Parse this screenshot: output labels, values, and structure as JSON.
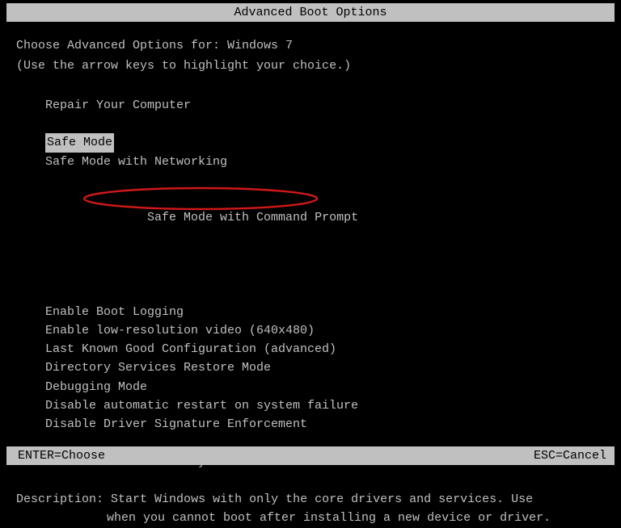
{
  "title": "Advanced Boot Options",
  "instruction1": "Choose Advanced Options for: Windows 7",
  "instruction2": "(Use the arrow keys to highlight your choice.)",
  "menu": {
    "repair": "Repair Your Computer",
    "safe_mode": "Safe Mode",
    "safe_mode_net": "Safe Mode with Networking",
    "safe_mode_cmd": "Safe Mode with Command Prompt",
    "boot_logging": "Enable Boot Logging",
    "low_res": "Enable low-resolution video (640x480)",
    "last_known": "Last Known Good Configuration (advanced)",
    "ds_restore": "Directory Services Restore Mode",
    "debugging": "Debugging Mode",
    "disable_restart": "Disable automatic restart on system failure",
    "disable_driver_sig": "Disable Driver Signature Enforcement",
    "start_normal": "Start Windows Normally"
  },
  "description": {
    "label": "Description:",
    "line1": "Start Windows with only the core drivers and services. Use",
    "line2": "when you cannot boot after installing a new device or driver."
  },
  "footer": {
    "enter": "ENTER=Choose",
    "esc": "ESC=Cancel"
  }
}
